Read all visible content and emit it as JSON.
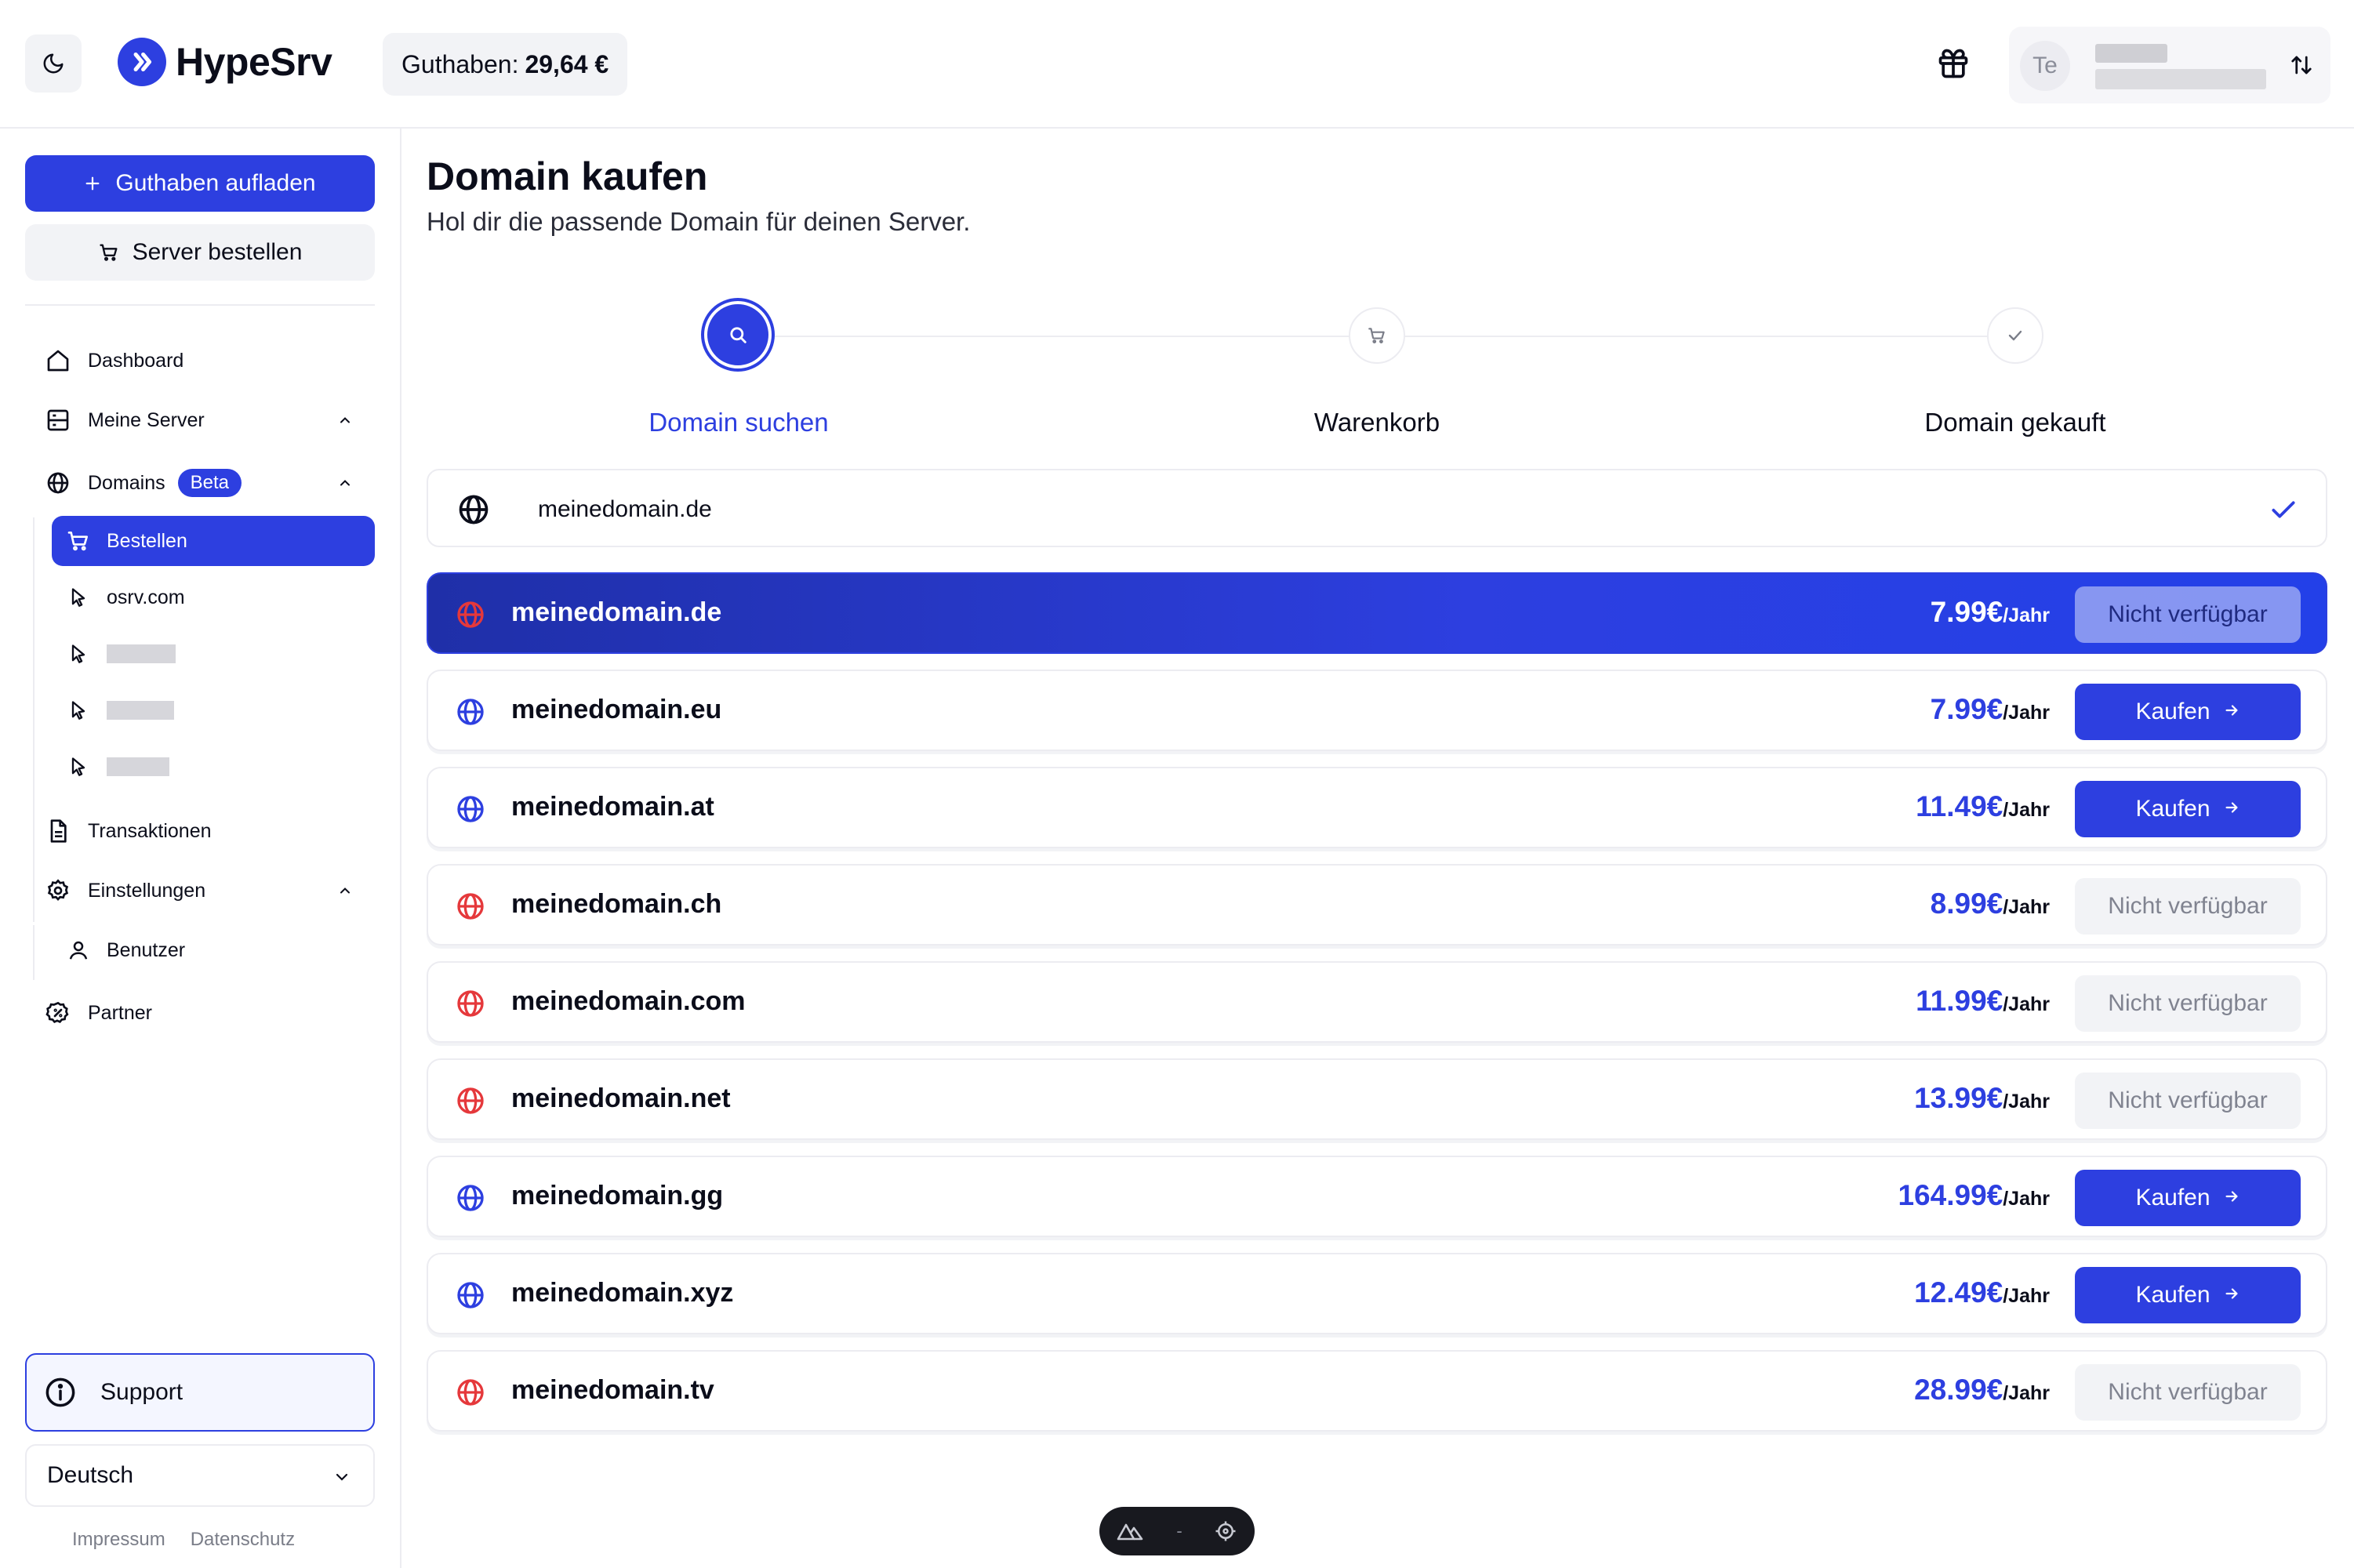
{
  "header": {
    "logo_text": "HypeSrv",
    "balance_label": "Guthaben:",
    "balance_value": "29,64 €",
    "avatar_initials": "Te"
  },
  "sidebar": {
    "topup_label": "Guthaben aufladen",
    "order_server_label": "Server bestellen",
    "nav": {
      "dashboard": "Dashboard",
      "servers": "Meine Server",
      "domains": "Domains",
      "domains_badge": "Beta",
      "order": "Bestellen",
      "domain1": "osrv.com",
      "transactions": "Transaktionen",
      "settings": "Einstellungen",
      "users": "Benutzer",
      "partner": "Partner"
    },
    "support_label": "Support",
    "language": "Deutsch",
    "imprint": "Impressum",
    "privacy": "Datenschutz"
  },
  "main": {
    "title": "Domain kaufen",
    "subtitle": "Hol dir die passende Domain für deinen Server.",
    "steps": [
      "Domain suchen",
      "Warenkorb",
      "Domain gekauft"
    ],
    "search_value": "meinedomain.de",
    "per_year": "/Jahr",
    "buy_label": "Kaufen",
    "unavailable_label": "Nicht verfügbar",
    "results": [
      {
        "domain": "meinedomain.de",
        "price": "7.99€",
        "available": false
      },
      {
        "domain": "meinedomain.eu",
        "price": "7.99€",
        "available": true
      },
      {
        "domain": "meinedomain.at",
        "price": "11.49€",
        "available": true
      },
      {
        "domain": "meinedomain.ch",
        "price": "8.99€",
        "available": false
      },
      {
        "domain": "meinedomain.com",
        "price": "11.99€",
        "available": false
      },
      {
        "domain": "meinedomain.net",
        "price": "13.99€",
        "available": false
      },
      {
        "domain": "meinedomain.gg",
        "price": "164.99€",
        "available": true
      },
      {
        "domain": "meinedomain.xyz",
        "price": "12.49€",
        "available": true
      },
      {
        "domain": "meinedomain.tv",
        "price": "28.99€",
        "available": false
      }
    ]
  },
  "dev_toolbar": {
    "separator": "-"
  },
  "colors": {
    "accent": "#2d3fe0",
    "unavailable_globe": "#e5383b",
    "available_globe": "#2d3fe0"
  }
}
